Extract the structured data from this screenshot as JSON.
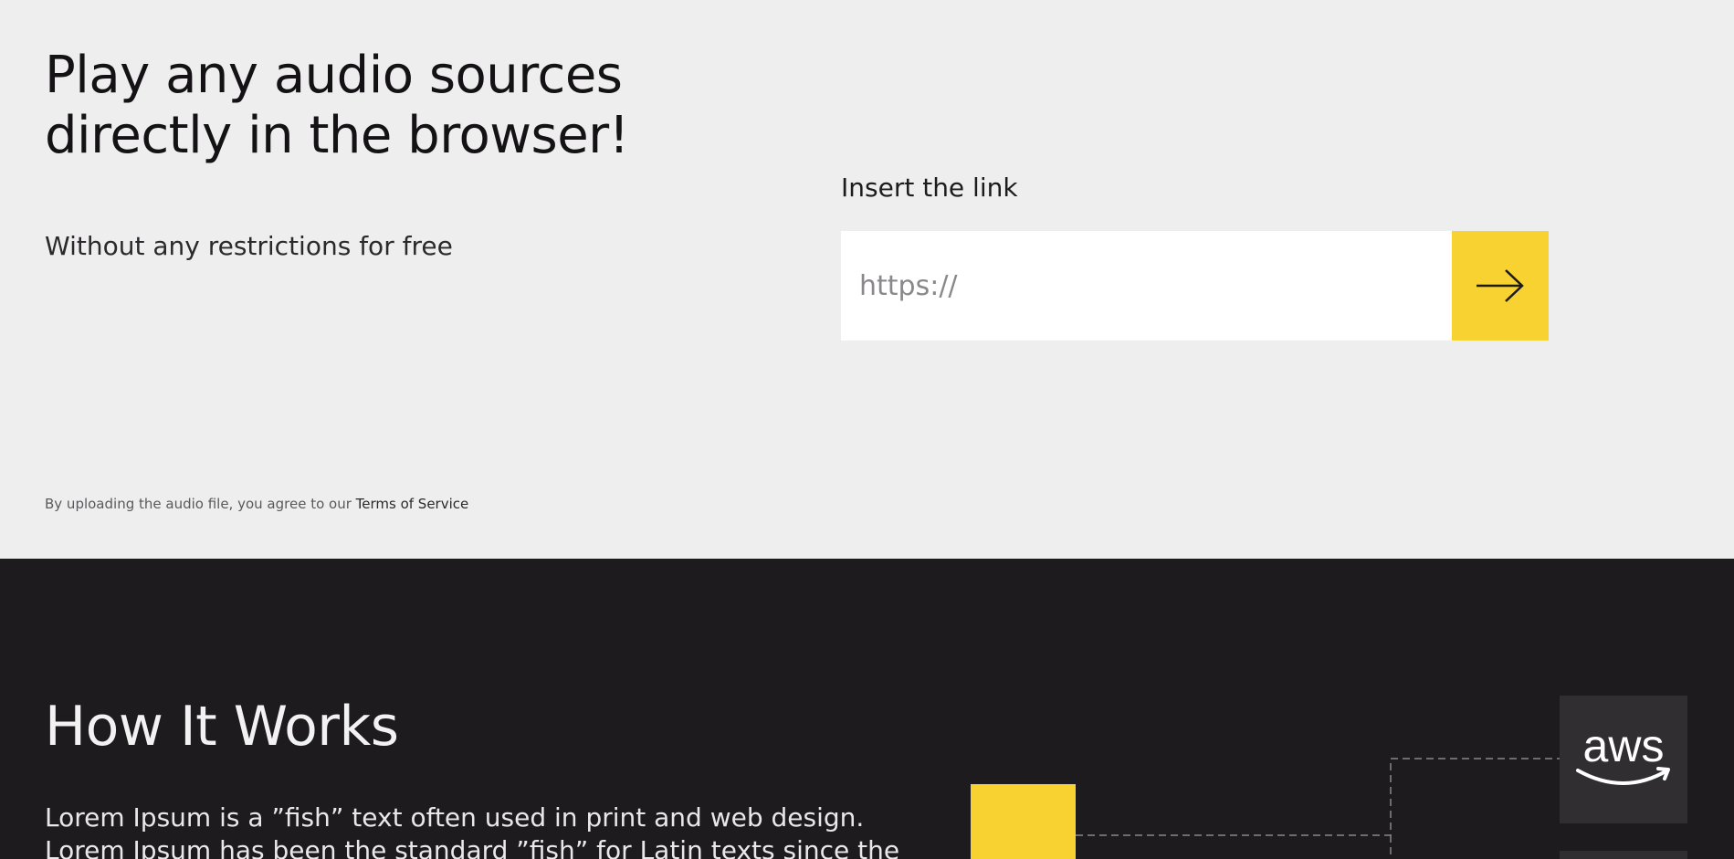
{
  "hero": {
    "title": "Play any audio sources directly in the browser!",
    "subtitle": "Without any restrictions for free",
    "input_label": "Insert the link",
    "input_placeholder": "https://",
    "submit_icon": "arrow-right-icon",
    "terms_prefix": "By uploading the audio file, you agree to our ",
    "terms_link": "Terms of Service"
  },
  "how_it_works": {
    "heading": "How It Works",
    "body": "Lorem Ipsum is a ”fish” text often used in print and web design. Lorem Ipsum has been the standard ”fish” for Latin texts since the",
    "provider_logo_text": "aws",
    "provider_logo_icon": "aws-logo-icon"
  },
  "colors": {
    "hero_bg": "#eeeeee",
    "dark_bg": "#1d1b1e",
    "accent": "#f8d230",
    "tile_bg": "#302e31"
  }
}
